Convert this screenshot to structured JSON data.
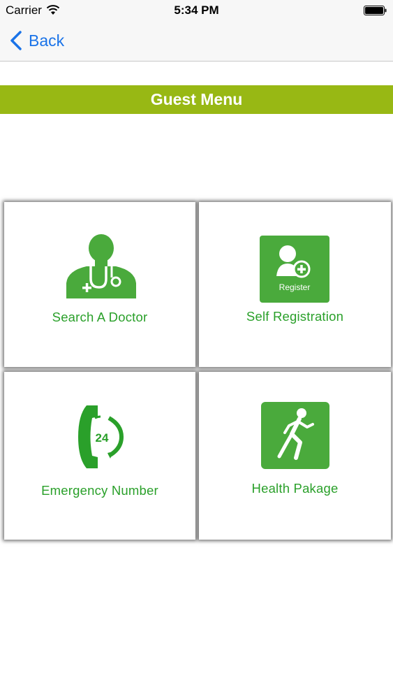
{
  "status_bar": {
    "carrier": "Carrier",
    "time": "5:34 PM"
  },
  "nav": {
    "back_label": "Back"
  },
  "header": {
    "title": "Guest Menu",
    "color": "#98b814"
  },
  "menu": {
    "accent_color": "#2aa02a",
    "icon_bg_color": "#4aaa3c",
    "items": [
      {
        "label": "Search A Doctor",
        "icon": "doctor-stethoscope-icon"
      },
      {
        "label": "Self Registration",
        "icon": "register-user-icon",
        "icon_text": "Register"
      },
      {
        "label": "Emergency Number",
        "icon": "phone-24-icon",
        "icon_text": "24"
      },
      {
        "label": "Health Pakage",
        "icon": "runner-icon"
      }
    ]
  }
}
